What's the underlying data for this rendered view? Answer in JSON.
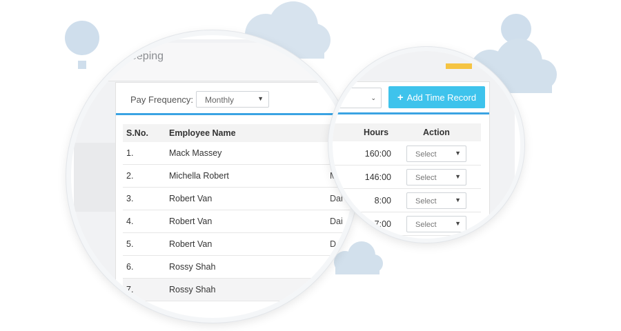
{
  "page": {
    "title": "eeping"
  },
  "toolbar": {
    "pay_frequency_label": "Pay Frequency:",
    "pay_frequency_value": "Monthly",
    "second_select_value": "",
    "add_button_label": "Add Time Record",
    "add_button_icon": "plus-icon"
  },
  "table": {
    "headers": {
      "sn": "S.No.",
      "name": "Employee Name",
      "hours": "Hours",
      "action": "Action"
    },
    "rows": [
      {
        "sn": "1.",
        "name": "Mack Massey",
        "type": "",
        "hours": "160:00",
        "action": "Select"
      },
      {
        "sn": "2.",
        "name": "Michella Robert",
        "type": "M",
        "hours": "146:00",
        "action": "Select"
      },
      {
        "sn": "3.",
        "name": "Robert Van",
        "type": "Dai",
        "hours": "8:00",
        "action": "Select"
      },
      {
        "sn": "4.",
        "name": "Robert Van",
        "type": "Dai",
        "hours": "7:00",
        "action": "Select"
      },
      {
        "sn": "5.",
        "name": "Robert Van",
        "type": "D",
        "hours": "",
        "action": ""
      },
      {
        "sn": "6.",
        "name": "Rossy Shah",
        "type": "",
        "hours": "",
        "action": ""
      },
      {
        "sn": "7.",
        "name": "Rossy Shah",
        "type": "",
        "hours": "",
        "action": ""
      }
    ]
  },
  "colors": {
    "accent": "#3ec3ec",
    "divider": "#3aa3e3",
    "cloud": "#c9d9e8"
  }
}
